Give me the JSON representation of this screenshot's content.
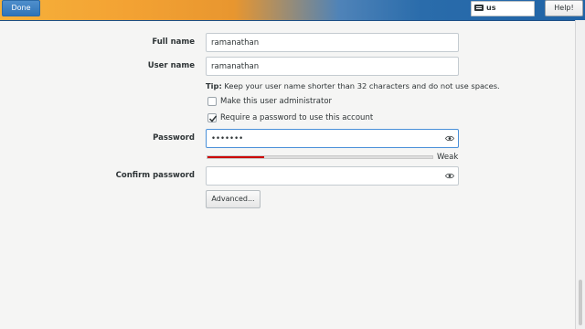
{
  "header": {
    "done_label": "Done",
    "help_label": "Help!",
    "keyboard_layout": "us"
  },
  "form": {
    "full_name": {
      "label": "Full name",
      "value": "ramanathan"
    },
    "user_name": {
      "label": "User name",
      "value": "ramanathan"
    },
    "tip": {
      "prefix": "Tip:",
      "text": "Keep your user name shorter than 32 characters and do not use spaces."
    },
    "options": {
      "admin": {
        "label": "Make this user administrator",
        "checked": false
      },
      "require_password": {
        "label": "Require a password to use this account",
        "checked": true
      }
    },
    "password": {
      "label": "Password",
      "masked_value": "•••••••",
      "strength_label": "Weak",
      "strength_fraction": 0.25
    },
    "confirm_password": {
      "label": "Confirm password",
      "value": ""
    },
    "advanced_button": "Advanced..."
  },
  "colors": {
    "primary": "#2f74b8",
    "focus_border": "#4a90d9",
    "weak_strength": "#cc0000"
  }
}
